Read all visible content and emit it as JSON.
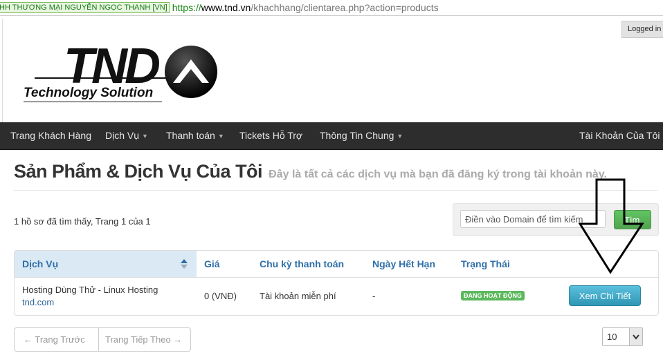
{
  "browser": {
    "cert_label": "HH THƯƠNG MẠI NGUYỄN NGỌC THANH [VN]",
    "url_scheme": "https://",
    "url_host": "www.tnd.vn",
    "url_path": "/khachhang/clientarea.php?action=products"
  },
  "header": {
    "logged_in": "Logged in a"
  },
  "logo": {
    "text": "TND",
    "tagline": "Technology Solution"
  },
  "nav": {
    "items": [
      {
        "label": "Trang Khách Hàng"
      },
      {
        "label": "Dịch Vụ"
      },
      {
        "label": "Thanh toán"
      },
      {
        "label": "Tickets Hỗ Trợ"
      },
      {
        "label": "Thông Tin Chung"
      }
    ],
    "account": "Tài Khoản Của Tôi"
  },
  "page": {
    "title": "Sản Phẩm & Dịch Vụ Của Tôi",
    "subtitle": "Đây là tất cả các dịch vụ mà bạn đã đăng ký trong tài khoản này.",
    "records": "1 hồ sơ đã tìm thấy, Trang 1 của 1"
  },
  "search": {
    "placeholder": "Điền vào Domain để tìm kiếm",
    "button": "Tìm"
  },
  "table": {
    "headers": [
      "Dịch Vụ",
      "Giá",
      "Chu kỳ thanh toán",
      "Ngày Hết Hạn",
      "Trạng Thái"
    ],
    "rows": [
      {
        "service": "Hosting Dùng Thử - Linux Hosting",
        "domain": "tnd.com",
        "price": "0 (VNĐ)",
        "cycle": "Tài khoản miễn phí",
        "expiry": "-",
        "status": "ĐANG HOẠT ĐỘNG",
        "action": "Xem Chi Tiết"
      }
    ]
  },
  "pagination": {
    "prev": "← Trang Trước",
    "next": "Trang Tiếp Theo →",
    "per_page": "10"
  },
  "colors": {
    "navbar": "#2d2d2d",
    "link": "#2f6fa7",
    "success": "#5cb85c",
    "info": "#5bc0de"
  }
}
